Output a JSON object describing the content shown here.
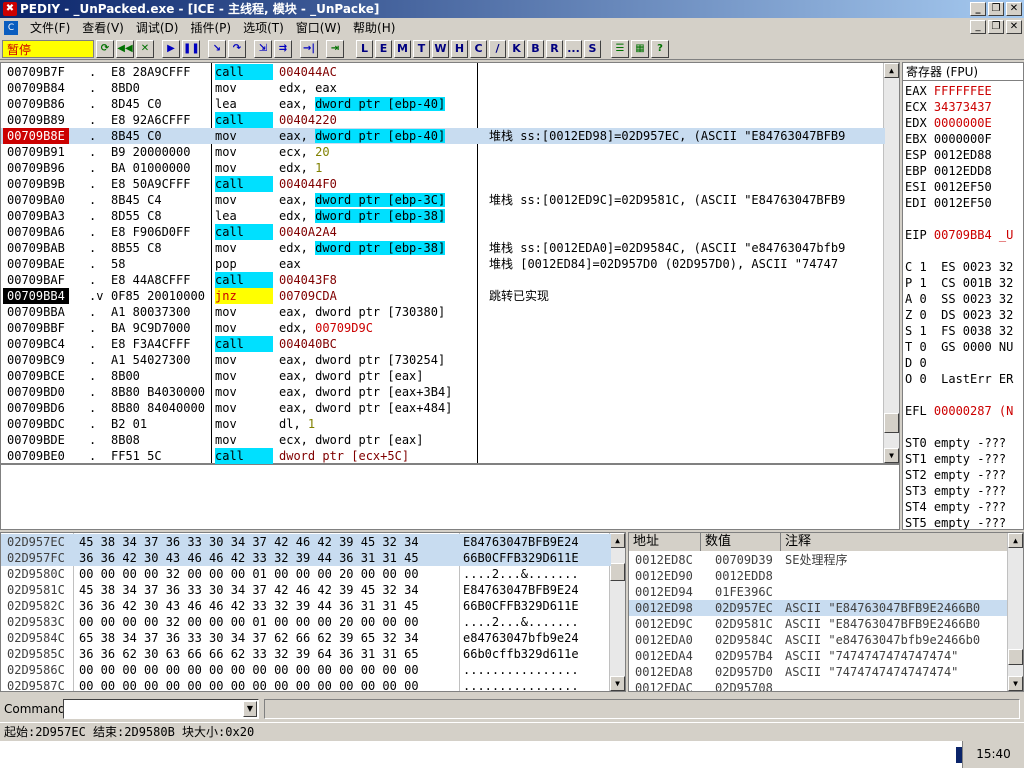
{
  "window": {
    "title": "PEDIY - _UnPacked.exe - [ICE - 主线程, 模块 - _UnPacke]"
  },
  "menu": [
    "文件(F)",
    "查看(V)",
    "调试(D)",
    "插件(P)",
    "选项(T)",
    "窗口(W)",
    "帮助(H)"
  ],
  "toolbar": {
    "status": "暂停",
    "letters": [
      "L",
      "E",
      "M",
      "T",
      "W",
      "H",
      "C",
      "/",
      "K",
      "B",
      "R",
      "...",
      "S"
    ]
  },
  "cpu": {
    "rows": [
      {
        "addr": "00709B7F",
        "hex": "E8 28A9CFFF",
        "mn": "call",
        "op": "004044AC",
        "kind": "call"
      },
      {
        "addr": "00709B84",
        "hex": "8BD0",
        "mn": "mov",
        "op": "edx, eax"
      },
      {
        "addr": "00709B86",
        "hex": "8D45 C0",
        "mn": "lea",
        "op_a": "eax, ",
        "op_hl": "dword ptr [ebp-40]"
      },
      {
        "addr": "00709B89",
        "hex": "E8 92A6CFFF",
        "mn": "call",
        "op": "00404220",
        "kind": "call"
      },
      {
        "addr": "00709B8E",
        "hex": "8B45 C0",
        "mn": "mov",
        "op_a": "eax, ",
        "op_hl": "dword ptr [ebp-40]",
        "bp": true,
        "sel": true,
        "cm": "堆栈 ss:[0012ED98]=02D957EC, (ASCII \"E84763047BFB9"
      },
      {
        "addr": "00709B91",
        "hex": "B9 20000000",
        "mn": "mov",
        "op_a": "ecx, ",
        "op_num": "20"
      },
      {
        "addr": "00709B96",
        "hex": "BA 01000000",
        "mn": "mov",
        "op_a": "edx, ",
        "op_num": "1"
      },
      {
        "addr": "00709B9B",
        "hex": "E8 50A9CFFF",
        "mn": "call",
        "op": "004044F0",
        "kind": "call"
      },
      {
        "addr": "00709BA0",
        "hex": "8B45 C4",
        "mn": "mov",
        "op_a": "eax, ",
        "op_hl": "dword ptr [ebp-3C]",
        "cm": "堆栈 ss:[0012ED9C]=02D9581C, (ASCII \"E84763047BFB9"
      },
      {
        "addr": "00709BA3",
        "hex": "8D55 C8",
        "mn": "lea",
        "op_a": "edx, ",
        "op_hl": "dword ptr [ebp-38]"
      },
      {
        "addr": "00709BA6",
        "hex": "E8 F906D0FF",
        "mn": "call",
        "op": "0040A2A4",
        "kind": "call"
      },
      {
        "addr": "00709BAB",
        "hex": "8B55 C8",
        "mn": "mov",
        "op_a": "edx, ",
        "op_hl": "dword ptr [ebp-38]",
        "cm": "堆栈 ss:[0012EDA0]=02D9584C, (ASCII \"e84763047bfb9"
      },
      {
        "addr": "00709BAE",
        "hex": "58",
        "mn": "pop",
        "op": "eax",
        "cm": "堆栈 [0012ED84]=02D957D0 (02D957D0), ASCII \"74747"
      },
      {
        "addr": "00709BAF",
        "hex": "E8 44A8CFFF",
        "mn": "call",
        "op": "004043F8",
        "kind": "call"
      },
      {
        "addr": "00709BB4",
        "hex": "0F85 20010000",
        "mn": "jnz",
        "op": "00709CDA",
        "kind": "jnz",
        "eip": true,
        "dot": ".v",
        "cm": "跳转已实现"
      },
      {
        "addr": "00709BBA",
        "hex": "A1 80037300",
        "mn": "mov",
        "op": "eax, dword ptr [730380]"
      },
      {
        "addr": "00709BBF",
        "hex": "BA 9C9D7000",
        "mn": "mov",
        "op_a": "edx, ",
        "op_red": "00709D9C"
      },
      {
        "addr": "00709BC4",
        "hex": "E8 F3A4CFFF",
        "mn": "call",
        "op": "004040BC",
        "kind": "call"
      },
      {
        "addr": "00709BC9",
        "hex": "A1 54027300",
        "mn": "mov",
        "op": "eax, dword ptr [730254]"
      },
      {
        "addr": "00709BCE",
        "hex": "8B00",
        "mn": "mov",
        "op": "eax, dword ptr [eax]"
      },
      {
        "addr": "00709BD0",
        "hex": "8B80 B4030000",
        "mn": "mov",
        "op": "eax, dword ptr [eax+3B4]"
      },
      {
        "addr": "00709BD6",
        "hex": "8B80 84040000",
        "mn": "mov",
        "op": "eax, dword ptr [eax+484]"
      },
      {
        "addr": "00709BDC",
        "hex": "B2 01",
        "mn": "mov",
        "op_a": "dl, ",
        "op_num": "1"
      },
      {
        "addr": "00709BDE",
        "hex": "8B08",
        "mn": "mov",
        "op": "ecx, dword ptr [eax]"
      },
      {
        "addr": "00709BE0",
        "hex": "FF51 5C",
        "mn": "call",
        "op": "dword ptr [ecx+5C]",
        "kind": "call"
      }
    ]
  },
  "registers": {
    "title": "寄存器 (FPU)",
    "rows": [
      {
        "t": "EAX FFFFFFEE",
        "red": true
      },
      {
        "t": "ECX 34373437",
        "red": true
      },
      {
        "t": "EDX 0000000E",
        "red": true
      },
      {
        "t": "EBX 0000000F"
      },
      {
        "t": "ESP 0012ED88"
      },
      {
        "t": "EBP 0012EDD8"
      },
      {
        "t": "ESI 0012EF50"
      },
      {
        "t": "EDI 0012EF50"
      },
      {
        "t": ""
      },
      {
        "t": "EIP 00709BB4 _U",
        "red": true
      },
      {
        "t": ""
      },
      {
        "t": "C 1  ES 0023 32"
      },
      {
        "t": "P 1  CS 001B 32"
      },
      {
        "t": "A 0  SS 0023 32"
      },
      {
        "t": "Z 0  DS 0023 32"
      },
      {
        "t": "S 1  FS 0038 32"
      },
      {
        "t": "T 0  GS 0000 NU"
      },
      {
        "t": "D 0"
      },
      {
        "t": "O 0  LastErr ER"
      },
      {
        "t": ""
      },
      {
        "t": "EFL 00000287 (N",
        "red": true
      },
      {
        "t": ""
      },
      {
        "t": "ST0 empty -???"
      },
      {
        "t": "ST1 empty -???"
      },
      {
        "t": "ST2 empty -???"
      },
      {
        "t": "ST3 empty -???"
      },
      {
        "t": "ST4 empty -???"
      },
      {
        "t": "ST5 empty -???"
      },
      {
        "t": "ST6 empty -???"
      },
      {
        "t": "ST7 empty -???"
      }
    ]
  },
  "dump": {
    "rows": [
      {
        "addr": "02D957EC",
        "hex": "45 38 34 37 36 33 30 34 37 42 46 42 39 45 32 34",
        "asc": "E84763047BFB9E24",
        "sel": true
      },
      {
        "addr": "02D957FC",
        "hex": "36 36 42 30 43 46 46 42 33 32 39 44 36 31 31 45",
        "asc": "66B0CFFB329D611E",
        "sel": true
      },
      {
        "addr": "02D9580C",
        "hex": "00 00 00 00 32 00 00 00 01 00 00 00 20 00 00 00",
        "asc": "....2...&....... "
      },
      {
        "addr": "02D9581C",
        "hex": "45 38 34 37 36 33 30 34 37 42 46 42 39 45 32 34",
        "asc": "E84763047BFB9E24"
      },
      {
        "addr": "02D9582C",
        "hex": "36 36 42 30 43 46 46 42 33 32 39 44 36 31 31 45",
        "asc": "66B0CFFB329D611E"
      },
      {
        "addr": "02D9583C",
        "hex": "00 00 00 00 32 00 00 00 01 00 00 00 20 00 00 00",
        "asc": "....2...&....... "
      },
      {
        "addr": "02D9584C",
        "hex": "65 38 34 37 36 33 30 34 37 62 66 62 39 65 32 34",
        "asc": "e84763047bfb9e24"
      },
      {
        "addr": "02D9585C",
        "hex": "36 36 62 30 63 66 66 62 33 32 39 64 36 31 31 65",
        "asc": "66b0cffb329d611e"
      },
      {
        "addr": "02D9586C",
        "hex": "00 00 00 00 00 00 00 00 00 00 00 00 00 00 00 00",
        "asc": "................"
      },
      {
        "addr": "02D9587C",
        "hex": "00 00 00 00 00 00 00 00 00 00 00 00 00 00 00 00",
        "asc": "................"
      }
    ]
  },
  "stack": {
    "headers": [
      "地址",
      "数值",
      "注释"
    ],
    "rows": [
      {
        "addr": "0012ED8C",
        "val": "00709D39",
        "cm": "SE处理程序"
      },
      {
        "addr": "0012ED90",
        "val": "0012EDD8",
        "cm": ""
      },
      {
        "addr": "0012ED94",
        "val": "01FE396C",
        "cm": ""
      },
      {
        "addr": "0012ED98",
        "val": "02D957EC",
        "cm": "ASCII \"E84763047BFB9E2466B0",
        "sel": true
      },
      {
        "addr": "0012ED9C",
        "val": "02D9581C",
        "cm": "ASCII \"E84763047BFB9E2466B0"
      },
      {
        "addr": "0012EDA0",
        "val": "02D9584C",
        "cm": "ASCII \"e84763047bfb9e2466b0"
      },
      {
        "addr": "0012EDA4",
        "val": "02D957B4",
        "cm": "ASCII \"7474747474747474\""
      },
      {
        "addr": "0012EDA8",
        "val": "02D957D0",
        "cm": "ASCII \"7474747474747474\""
      },
      {
        "addr": "0012EDAC",
        "val": "02D95708",
        "cm": ""
      }
    ]
  },
  "command": {
    "label": "Command",
    "value": ""
  },
  "statusbar": {
    "text": "起始:2D957EC 结束:2D9580B 块大小:0x20"
  },
  "taskbar": {
    "time": "15:40"
  }
}
